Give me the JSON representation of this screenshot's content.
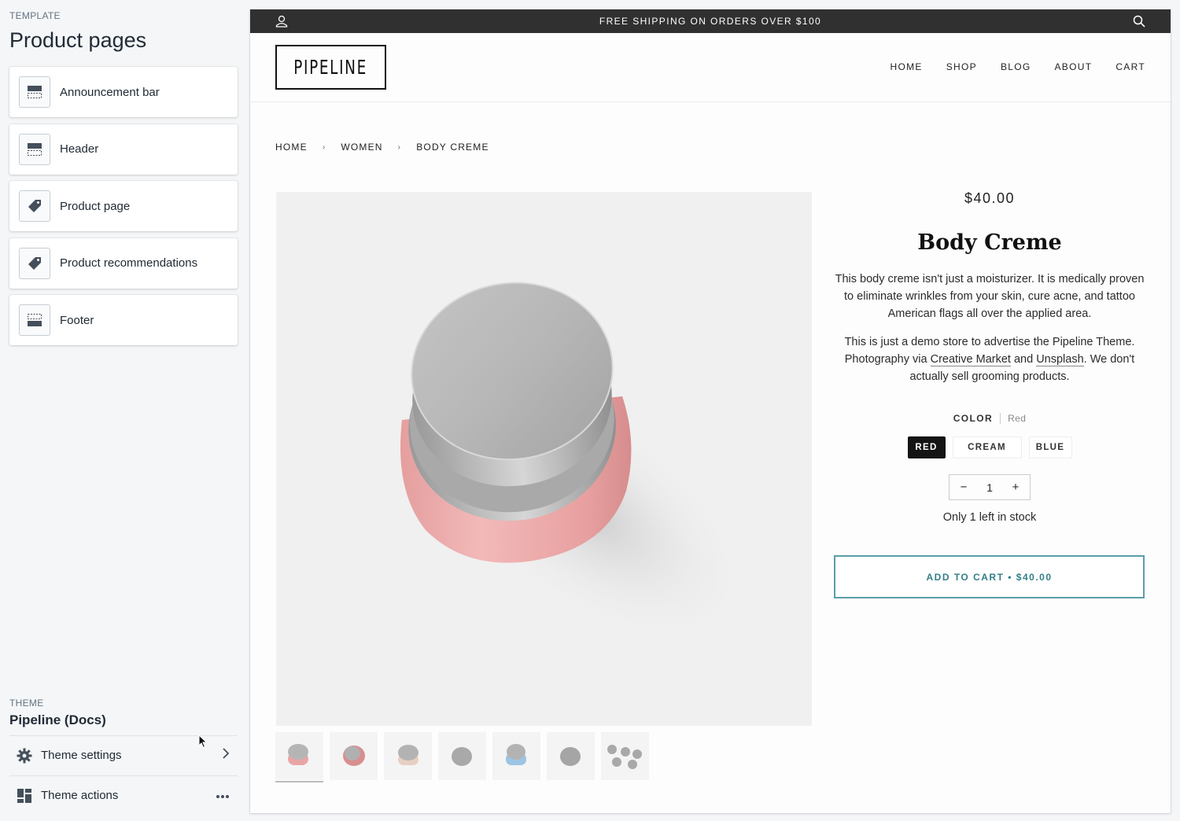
{
  "sidebar": {
    "caption": "TEMPLATE",
    "title": "Product pages",
    "sections": [
      {
        "label": "Announcement bar",
        "icon": "announcement-bar-icon"
      },
      {
        "label": "Header",
        "icon": "header-icon"
      },
      {
        "label": "Product page",
        "icon": "tag-icon"
      },
      {
        "label": "Product recommendations",
        "icon": "tag-icon"
      },
      {
        "label": "Footer",
        "icon": "footer-icon"
      }
    ],
    "theme_caption": "THEME",
    "theme_name": "Pipeline (Docs)",
    "theme_settings_label": "Theme settings",
    "theme_actions_label": "Theme actions"
  },
  "store": {
    "announcement": "FREE SHIPPING ON ORDERS OVER $100",
    "logo": "PIPELINE",
    "nav": [
      "HOME",
      "SHOP",
      "BLOG",
      "ABOUT",
      "CART"
    ],
    "breadcrumb": [
      "HOME",
      "WOMEN",
      "BODY CREME"
    ]
  },
  "product": {
    "price": "$40.00",
    "title": "Body Creme",
    "description_1": "This body creme isn't just a moisturizer.  It is medically proven to eliminate wrinkles from your skin, cure acne, and tattoo American flags all over the applied area.",
    "description_2_a": "This is just a demo store to advertise the Pipeline Theme.  Photography via ",
    "link_creative": "Creative Market",
    "description_2_and": " and ",
    "link_unsplash": "Unsplash",
    "description_2_b": ".  We don't actually sell grooming products.",
    "color_label": "COLOR",
    "color_value": "Red",
    "swatches": [
      "RED",
      "CREAM",
      "BLUE"
    ],
    "selected_swatch": "RED",
    "quantity_minus": "−",
    "quantity": "1",
    "quantity_plus": "+",
    "stock_text": "Only 1 left in stock",
    "add_to_cart": "ADD TO CART • $40.00"
  },
  "colors": {
    "accent": "#327f89",
    "announcement_bg": "#303030",
    "jar_pink": "#e9a7a7"
  }
}
